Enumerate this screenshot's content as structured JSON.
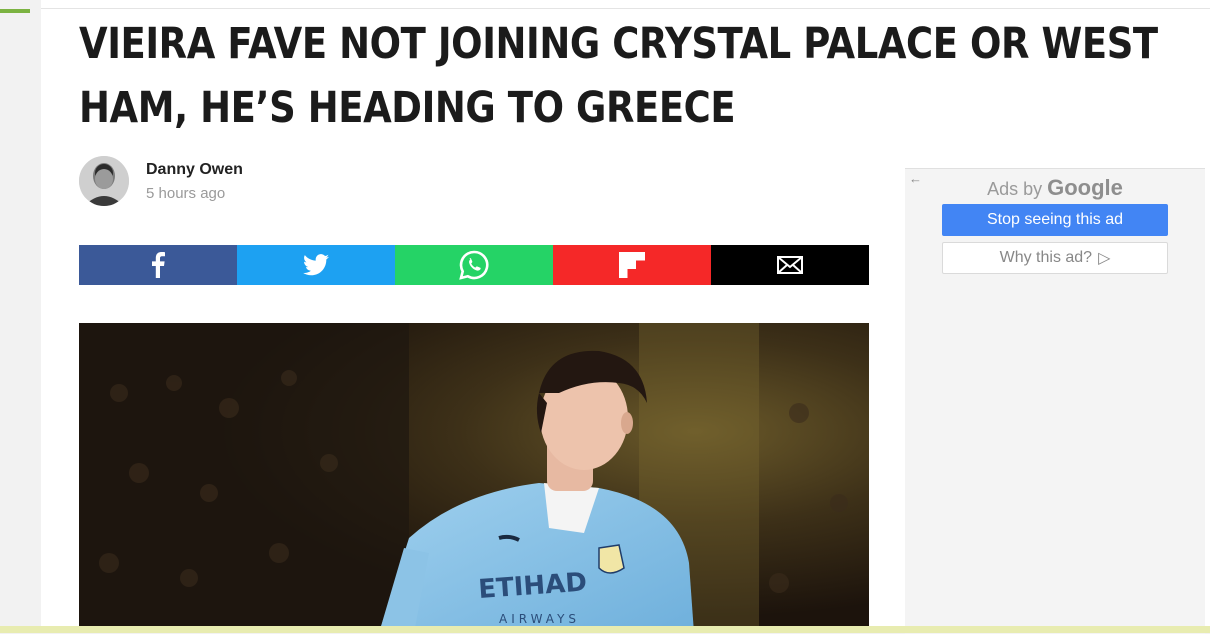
{
  "article": {
    "title_line1": "VIEIRA FAVE NOT JOINING CRYSTAL PALACE OR WEST",
    "title_line2": "HAM, HE’S HEADING TO GREECE",
    "author": "Danny Owen",
    "time": "5 hours ago"
  },
  "share": {
    "items": [
      "facebook-icon",
      "twitter-icon",
      "whatsapp-icon",
      "flipboard-icon",
      "email-icon"
    ],
    "colors": {
      "facebook": "#3b5998",
      "twitter": "#1da1f2",
      "whatsapp": "#25d366",
      "flipboard": "#f52828",
      "email": "#000000"
    }
  },
  "ad": {
    "back_glyph": "←",
    "label_prefix": "Ads by",
    "label_brand": "Google",
    "stop_label": "Stop seeing this ad",
    "why_label": "Why this ad?",
    "why_icon": "▷",
    "accent": "#4285f4"
  },
  "hero": {
    "jersey_sponsor": "ETIHAD",
    "jersey_sub": "AIRWAYS"
  }
}
